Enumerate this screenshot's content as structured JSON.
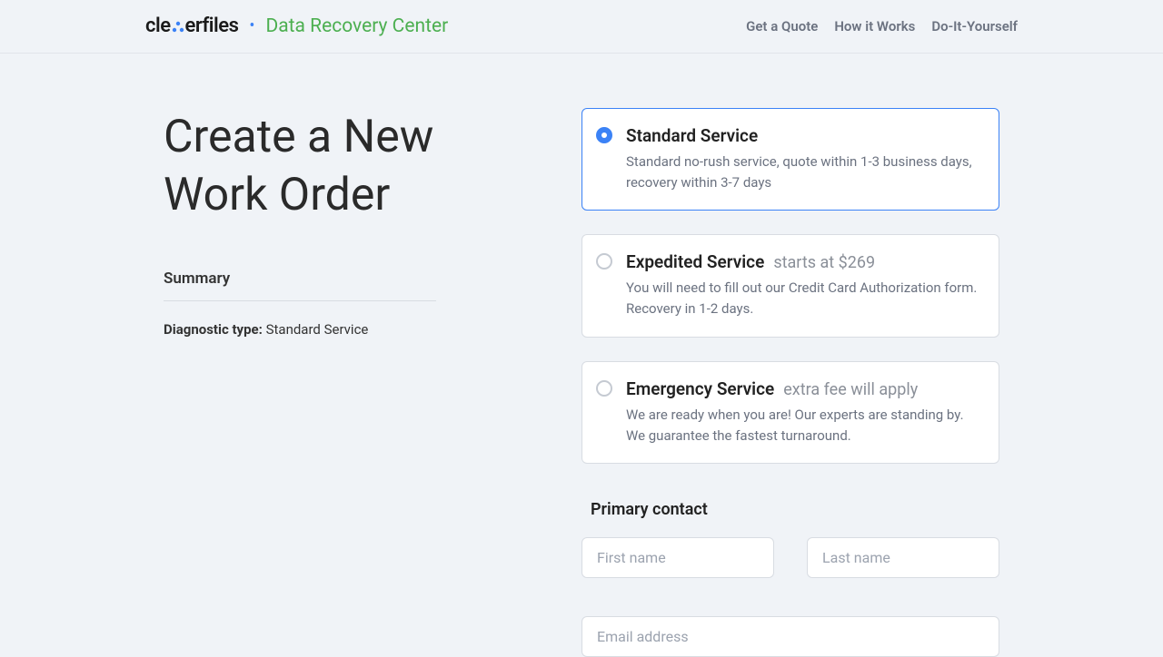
{
  "header": {
    "brand_prefix": "cle",
    "brand_suffix": "erfiles",
    "subtitle": "Data Recovery Center",
    "nav": {
      "quote": "Get a Quote",
      "how": "How it Works",
      "diy": "Do-It-Yourself"
    }
  },
  "page": {
    "title": "Create a New Work Order"
  },
  "summary": {
    "heading": "Summary",
    "diagnostic_label": "Diagnostic type:",
    "diagnostic_value": " Standard Service"
  },
  "options": {
    "standard": {
      "title": "Standard Service",
      "desc": "Standard no-rush service, quote within 1-3 business days, recovery within 3-7 days"
    },
    "expedited": {
      "title": "Expedited Service",
      "price": "starts at $269",
      "desc": "You will need to fill out our Credit Card Authorization form. Recovery in 1-2 days."
    },
    "emergency": {
      "title": "Emergency Service",
      "price": "extra fee will apply",
      "desc": "We are ready when you are! Our experts are standing by. We guarantee the fastest turnaround."
    }
  },
  "contact": {
    "heading": "Primary contact",
    "first_name_ph": "First name",
    "last_name_ph": "Last name",
    "email_ph": "Email address"
  }
}
